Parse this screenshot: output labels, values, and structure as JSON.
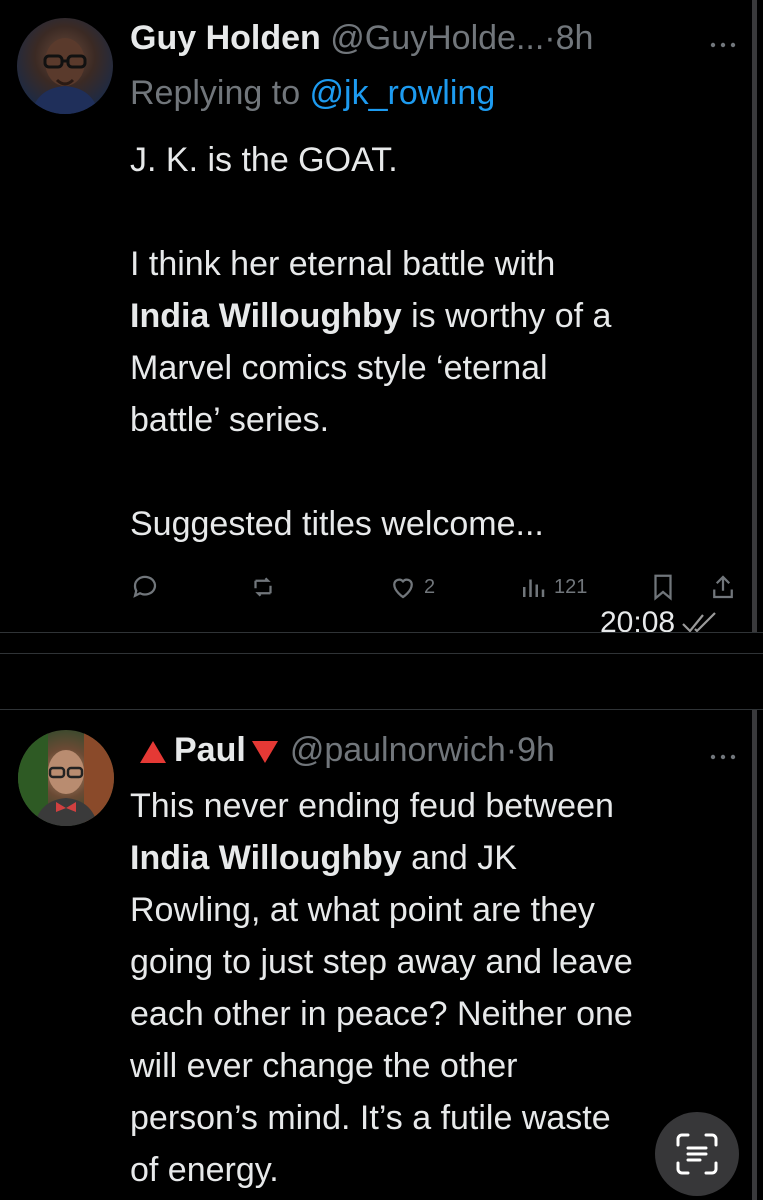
{
  "tweets": [
    {
      "name": "Guy Holden",
      "handle": "@GuyHolde...",
      "separator": "·",
      "age": "8h",
      "reply_prefix": "Replying to ",
      "reply_to": "@jk_rowling",
      "body": {
        "l1": "J. K. is the GOAT.",
        "l2": "I think her eternal battle with",
        "l3_bold": "India Willoughby",
        "l3_rest": " is worthy of a",
        "l4": "Marvel comics style ‘eternal",
        "l5": "battle’ series.",
        "l6": "Suggested titles welcome..."
      },
      "actions": {
        "replies": "",
        "reposts": "",
        "likes": "2",
        "views": "121"
      },
      "more_icon": "ellipsis-icon"
    },
    {
      "name": "Paul",
      "handle": "@paulnorwich",
      "separator": "·",
      "age": "9h",
      "body": {
        "l1": "This never ending feud between",
        "l2_bold": "India Willoughby",
        "l2_rest": " and JK",
        "l3": "Rowling, at what point are they",
        "l4": "going to just step away and leave",
        "l5": "each other in peace? Neither one",
        "l6": "will ever change the other",
        "l7": "person’s mind. It’s a futile waste",
        "l8": "of energy."
      },
      "more_icon": "ellipsis-icon"
    }
  ],
  "message_meta": {
    "time": "20:08",
    "status_icon": "double-check-icon"
  },
  "colors": {
    "background": "#000000",
    "text": "#e7e9ea",
    "muted": "#71767b",
    "link": "#1d9bf0",
    "flag": "#e53935"
  }
}
